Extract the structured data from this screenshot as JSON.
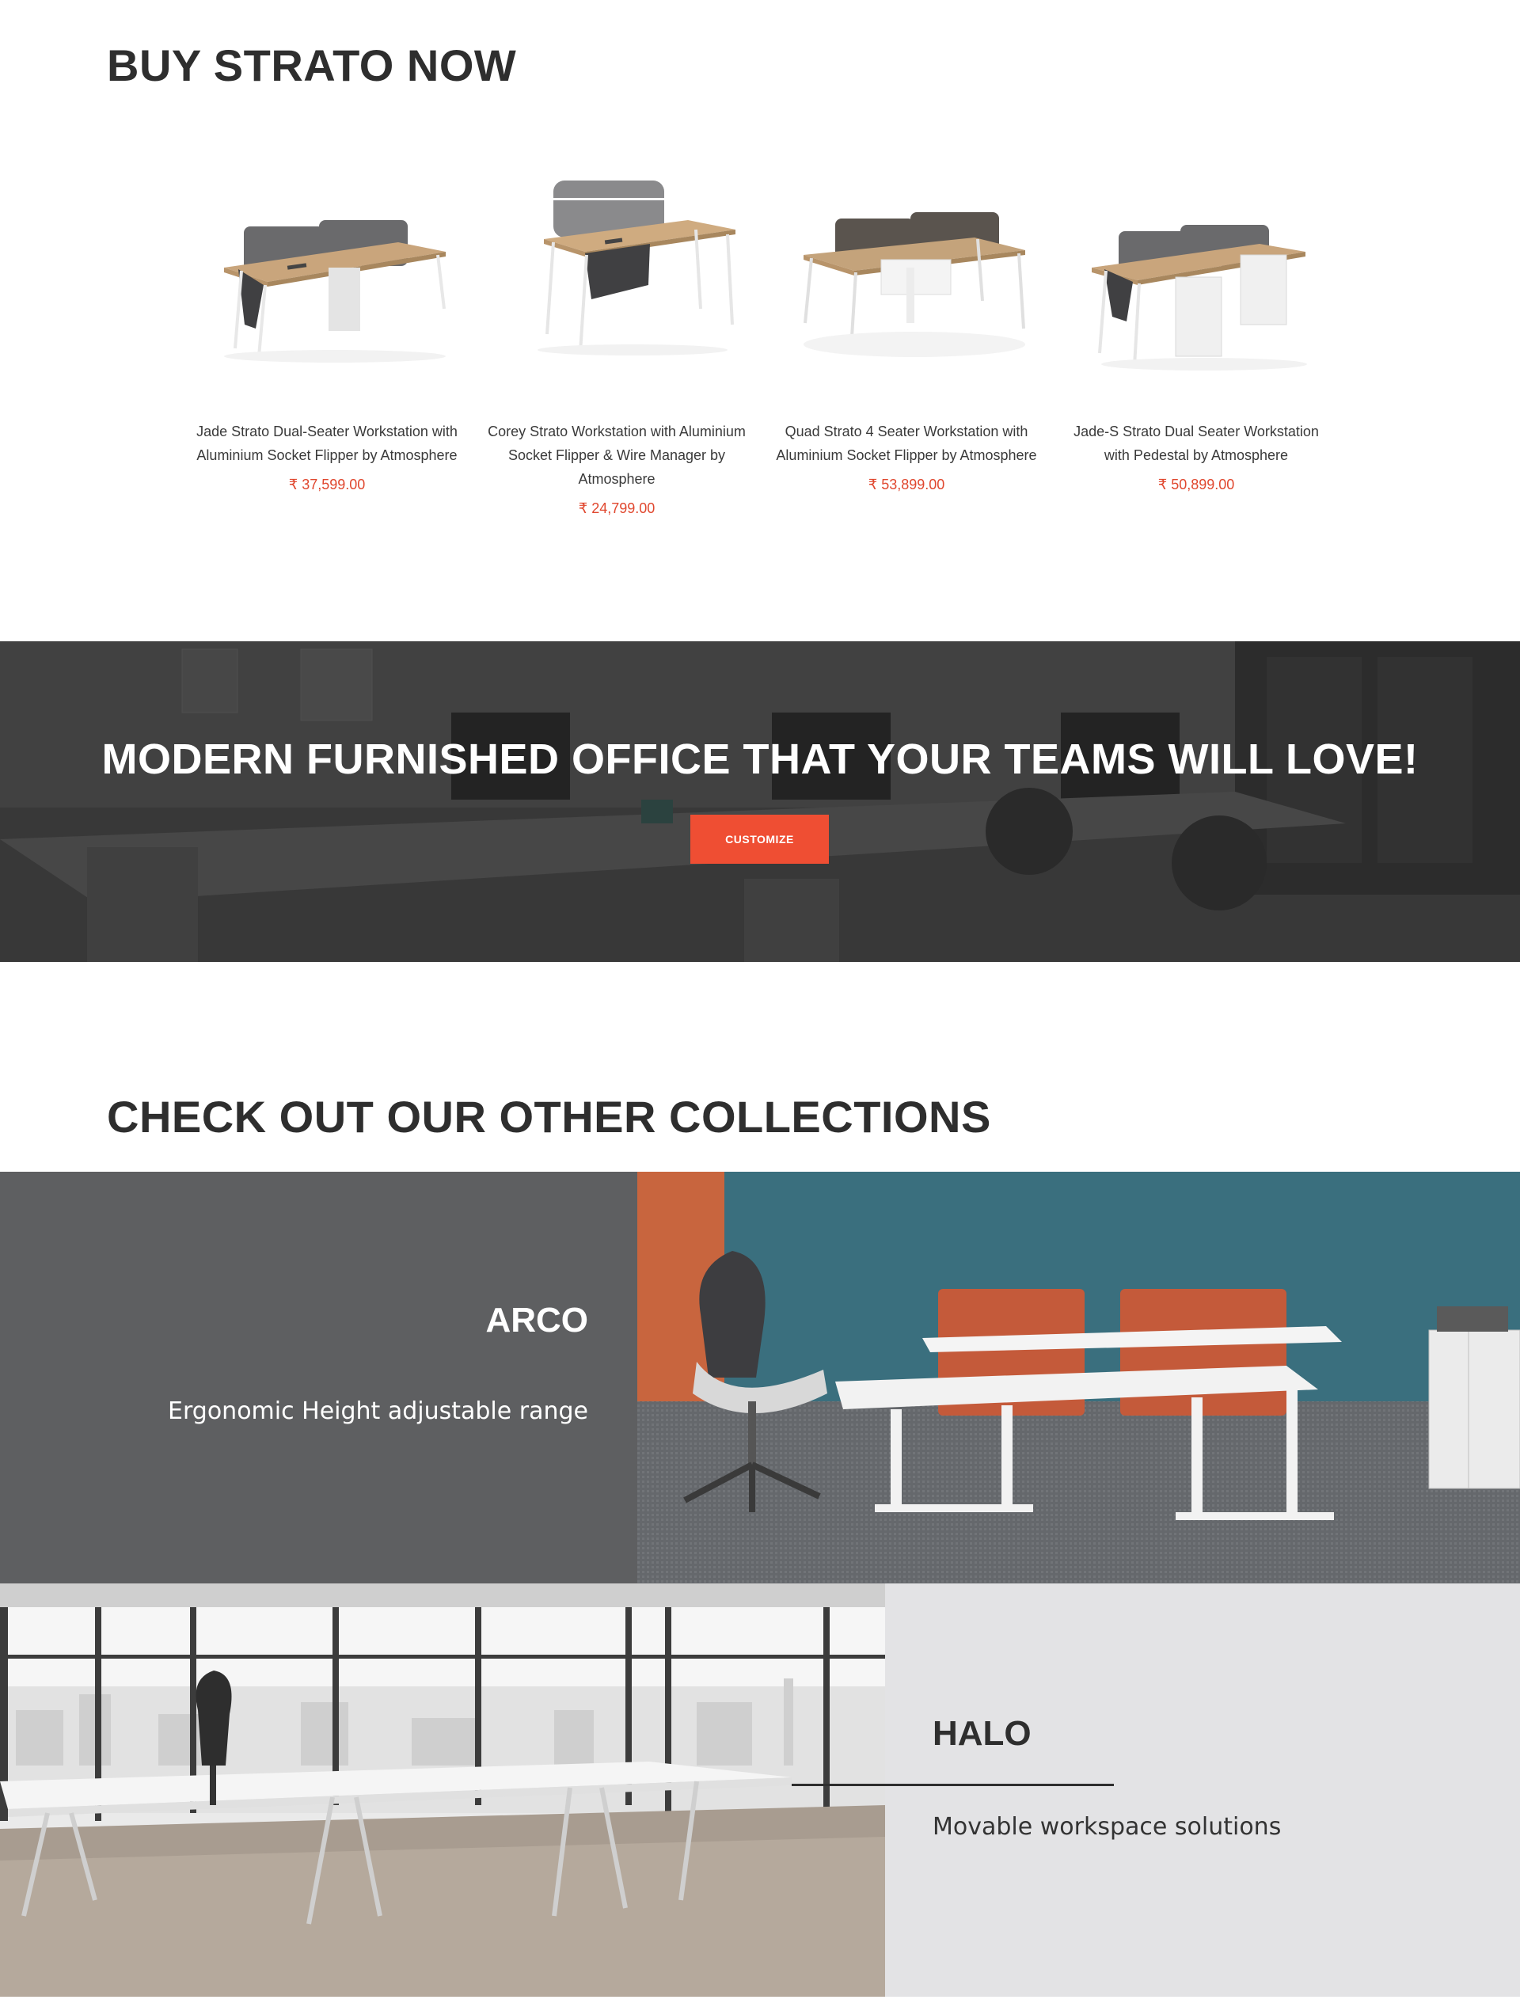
{
  "buy_section": {
    "title": "BUY STRATO NOW",
    "products": [
      {
        "name": "Jade Strato Dual-Seater Workstation with Aluminium Socket Flipper by Atmosphere",
        "price": "₹ 37,599.00"
      },
      {
        "name": "Corey Strato Workstation with Aluminium Socket Flipper & Wire Manager by Atmosphere",
        "price": "₹ 24,799.00"
      },
      {
        "name": "Quad Strato 4 Seater Workstation with Aluminium Socket Flipper by Atmosphere",
        "price": "₹ 53,899.00"
      },
      {
        "name": "Jade-S Strato Dual Seater Workstation with Pedestal by Atmosphere",
        "price": "₹ 50,899.00"
      }
    ]
  },
  "hero": {
    "title": "MODERN FURNISHED OFFICE THAT YOUR TEAMS WILL LOVE!",
    "button_label": "CUSTOMIZE"
  },
  "collections": {
    "title": "CHECK OUT OUR OTHER COLLECTIONS",
    "arco": {
      "name": "ARCO",
      "tagline": "Ergonomic Height adjustable range"
    },
    "halo": {
      "name": "HALO",
      "tagline": "Movable workspace solutions"
    }
  },
  "colors": {
    "accent": "#ef4e33",
    "price": "#e0472e",
    "arco_panel": "#5e5f61",
    "halo_panel": "#e3e3e5",
    "teal_wall": "#3a6f7e"
  }
}
